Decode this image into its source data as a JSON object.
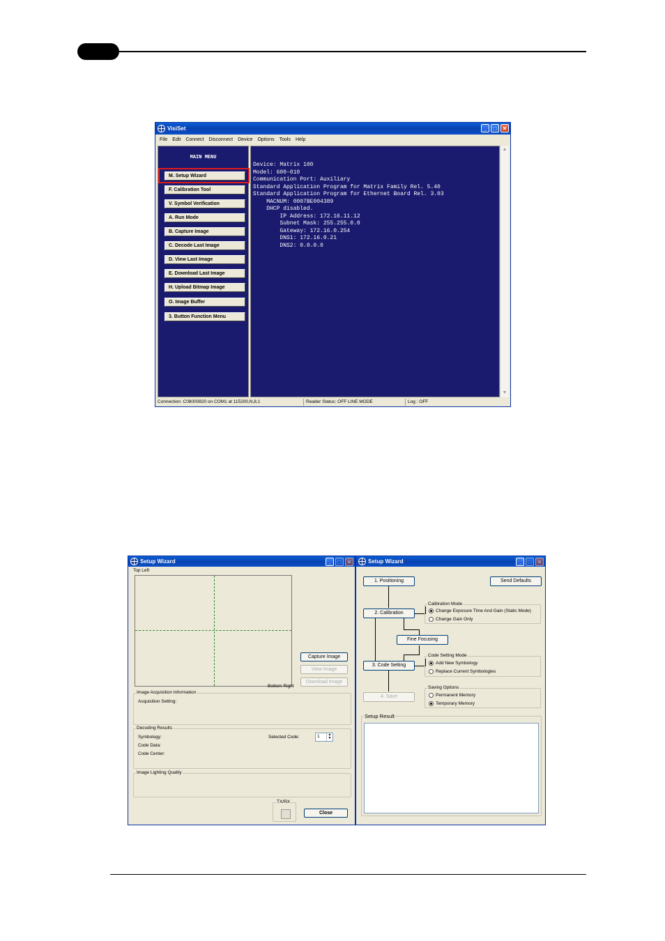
{
  "visiset": {
    "title": "VisiSet",
    "menu": [
      "File",
      "Edit",
      "Connect",
      "Disconnect",
      "Device",
      "Options",
      "Tools",
      "Help"
    ],
    "main_menu_title": "MAIN MENU",
    "buttons": [
      "M. Setup Wizard",
      "F. Calibration Tool",
      "V. Symbol Verification",
      "A. Run Mode",
      "B. Capture Image",
      "C. Decode Last Image",
      "D. View Last Image",
      "E. Download Last Image",
      "H. Upload Bitmap Image",
      "O. Image Buffer",
      "3. Button Function Menu"
    ],
    "console_lines": [
      "Device: Matrix 100",
      "Model: 600-010",
      "Communication Port: Auxiliary",
      "",
      "Standard Application Program for Matrix Family Rel. 5.40",
      "Standard Application Program for Ethernet Board Rel. 3.03",
      "    MACNUM: 0007BE004389",
      "    DHCP disabled.",
      "        IP Address: 172.16.11.12",
      "        Subnet Mask: 255.255.0.0",
      "        Gateway: 172.16.0.254",
      "        DNS1: 172.16.0.21",
      "        DNS2: 0.0.0.0"
    ],
    "status": {
      "connection": "Connection: C08000820 on COM1 at 115200,N,8,1",
      "reader_status": "Reader Status: OFF LINE MODE",
      "log": "Log : OFF"
    }
  },
  "wizard_left": {
    "title": "Setup Wizard",
    "top_left": "Top Left",
    "bottom_right": "Bottom Right",
    "capture_image": "Capture Image",
    "view_image": "View Image",
    "download_image": "Download Image",
    "acq_group": "Image Acquisition Information",
    "acq_setting": "Acquisition Setting:",
    "decoding_group": "Decoding Results",
    "symbology": "Symbology:",
    "code_data": "Code Data:",
    "code_center": "Code Center:",
    "selected_code": "Selected Code:",
    "selected_code_value": "1",
    "lighting_group": "Image Lighting Quality",
    "txrx": "TX/RX",
    "close": "Close"
  },
  "wizard_right": {
    "title": "Setup Wizard",
    "positioning": "1. Positioning",
    "send_defaults": "Send Defaults",
    "calibration": "2. Calibration",
    "fine_focusing": "Fine Focusing",
    "code_setting": "3. Code Setting",
    "save": "4. Save",
    "calibration_mode": "Calibration Mode",
    "cal_opt1": "Change Exposure Time And Gain (Static Mode)",
    "cal_opt2": "Change Gain Only",
    "code_setting_mode": "Code Setting Mode",
    "code_opt1": "Add New Symbology",
    "code_opt2": "Replace Current Symbologies",
    "saving_options": "Saving Options",
    "save_opt1": "Permanent Memory",
    "save_opt2": "Temporary Memory",
    "setup_result": "Setup Result"
  }
}
